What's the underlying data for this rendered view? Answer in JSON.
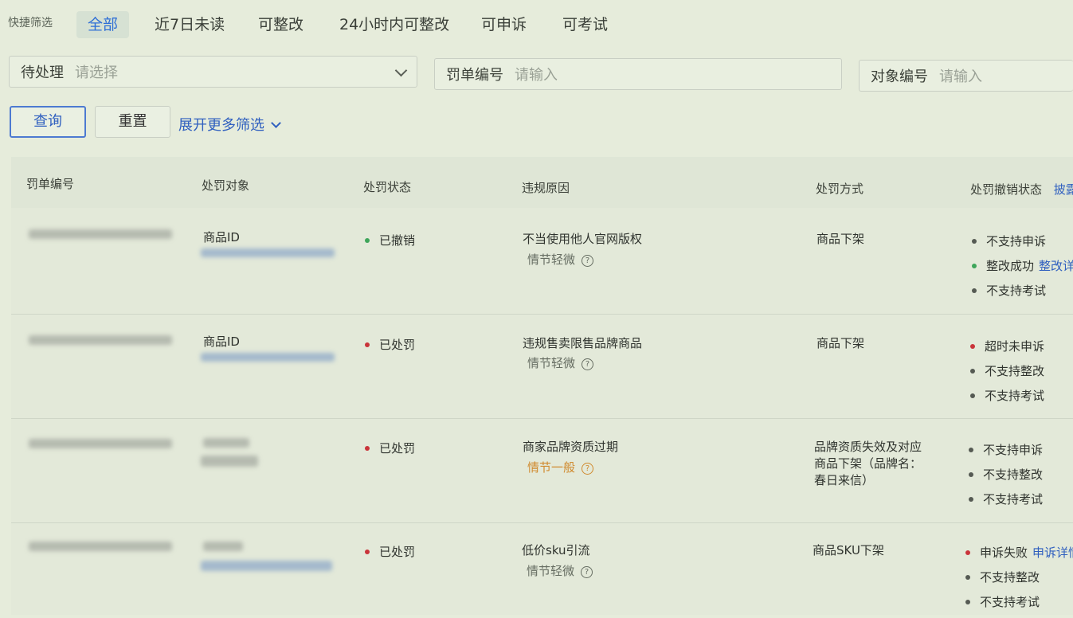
{
  "quick_filter": {
    "label": "快捷筛选",
    "tabs": [
      {
        "label": "全部",
        "active": true
      },
      {
        "label": "近7日未读",
        "active": false
      },
      {
        "label": "可整改",
        "active": false
      },
      {
        "label": "24小时内可整改",
        "active": false
      },
      {
        "label": "可申诉",
        "active": false
      },
      {
        "label": "可考试",
        "active": false
      }
    ]
  },
  "filters": {
    "status": {
      "label": "待处理",
      "placeholder": "请选择"
    },
    "ticket_no": {
      "label": "罚单编号",
      "placeholder": "请输入"
    },
    "object_no": {
      "label": "对象编号",
      "placeholder": "请输入"
    }
  },
  "actions": {
    "query": "查询",
    "reset": "重置",
    "more": "展开更多筛选"
  },
  "table": {
    "headers": {
      "ticket": "罚单编号",
      "object": "处罚对象",
      "status": "处罚状态",
      "reason": "违规原因",
      "method": "处罚方式",
      "revoke": "处罚撤销状态",
      "revoke_extra": "披露"
    },
    "rows": [
      {
        "object_label": "商品ID",
        "status": "已撤销",
        "status_color": "green",
        "reason": "不当使用他人官网版权",
        "severity": "情节轻微",
        "severity_color": "gray",
        "method": "商品下架",
        "revoke": [
          {
            "text": "不支持申诉",
            "dot": "gray",
            "link": ""
          },
          {
            "text": "整改成功",
            "dot": "green",
            "link": "整改详"
          },
          {
            "text": "不支持考试",
            "dot": "gray",
            "link": ""
          }
        ]
      },
      {
        "object_label": "商品ID",
        "status": "已处罚",
        "status_color": "red",
        "reason": "违规售卖限售品牌商品",
        "severity": "情节轻微",
        "severity_color": "gray",
        "method": "商品下架",
        "revoke": [
          {
            "text": "超时未申诉",
            "dot": "red",
            "link": ""
          },
          {
            "text": "不支持整改",
            "dot": "gray",
            "link": ""
          },
          {
            "text": "不支持考试",
            "dot": "gray",
            "link": ""
          }
        ]
      },
      {
        "object_label": "",
        "status": "已处罚",
        "status_color": "red",
        "reason": "商家品牌资质过期",
        "severity": "情节一般",
        "severity_color": "orange",
        "method": "品牌资质失效及对应商品下架（品牌名：春日来信）",
        "revoke": [
          {
            "text": "不支持申诉",
            "dot": "gray",
            "link": ""
          },
          {
            "text": "不支持整改",
            "dot": "gray",
            "link": ""
          },
          {
            "text": "不支持考试",
            "dot": "gray",
            "link": ""
          }
        ]
      },
      {
        "object_label": "",
        "status": "已处罚",
        "status_color": "red",
        "reason": "低价sku引流",
        "severity": "情节轻微",
        "severity_color": "gray",
        "method": "商品SKU下架",
        "revoke": [
          {
            "text": "申诉失败",
            "dot": "red",
            "link": "申诉详情"
          },
          {
            "text": "不支持整改",
            "dot": "gray",
            "link": ""
          },
          {
            "text": "不支持考试",
            "dot": "gray",
            "link": ""
          }
        ]
      }
    ]
  }
}
